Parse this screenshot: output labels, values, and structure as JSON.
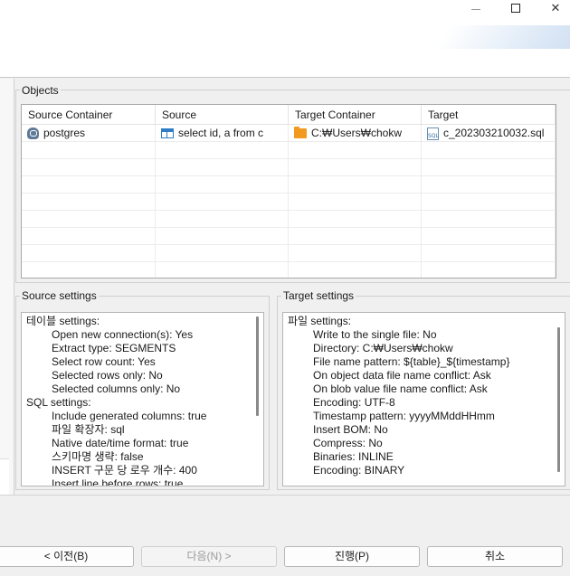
{
  "window": {
    "minimize_icon": "minimize-icon",
    "maximize_icon": "maximize-icon",
    "close_icon": "close-icon",
    "close_glyph": "✕"
  },
  "objects": {
    "title": "Objects",
    "columns": [
      "Source Container",
      "Source",
      "Target Container",
      "Target"
    ],
    "rows": [
      {
        "source_container": "postgres",
        "source_container_icon": "postgres-icon",
        "source": "select id, a from c",
        "source_icon": "table-icon",
        "target_container": "C:₩Users₩chokw",
        "target_container_icon": "folder-icon",
        "target": "c_202303210032.sql",
        "target_icon": "sql-file-icon"
      }
    ]
  },
  "source_settings": {
    "title": "Source settings",
    "lines": [
      {
        "text": "테이블 settings:",
        "indent": false
      },
      {
        "text": "Open new connection(s): Yes",
        "indent": true
      },
      {
        "text": "Extract type: SEGMENTS",
        "indent": true
      },
      {
        "text": "Select row count: Yes",
        "indent": true
      },
      {
        "text": "Selected rows only: No",
        "indent": true
      },
      {
        "text": "Selected columns only: No",
        "indent": true
      },
      {
        "text": "SQL settings:",
        "indent": false
      },
      {
        "text": "Include generated columns: true",
        "indent": true
      },
      {
        "text": "파일 확장자: sql",
        "indent": true
      },
      {
        "text": "Native date/time format: true",
        "indent": true
      },
      {
        "text": "스키마명 생략: false",
        "indent": true
      },
      {
        "text": "INSERT 구문 당 로우 개수: 400",
        "indent": true
      },
      {
        "text": "Insert line before rows: true",
        "indent": true
      }
    ]
  },
  "target_settings": {
    "title": "Target settings",
    "lines": [
      {
        "text": "파일 settings:",
        "indent": false
      },
      {
        "text": "Write to the single file: No",
        "indent": true
      },
      {
        "text": "Directory: C:₩Users₩chokw",
        "indent": true
      },
      {
        "text": "File name pattern: ${table}_${timestamp}",
        "indent": true
      },
      {
        "text": "On object data file name conflict: Ask",
        "indent": true
      },
      {
        "text": "On blob value file name conflict: Ask",
        "indent": true
      },
      {
        "text": "Encoding: UTF-8",
        "indent": true
      },
      {
        "text": "Timestamp pattern: yyyyMMddHHmm",
        "indent": true
      },
      {
        "text": "Insert BOM: No",
        "indent": true
      },
      {
        "text": "Compress: No",
        "indent": true
      },
      {
        "text": "Binaries: INLINE",
        "indent": true
      },
      {
        "text": "Encoding: BINARY",
        "indent": true
      }
    ]
  },
  "buttons": {
    "back": "< 이전(B)",
    "next": "다음(N) >",
    "proceed": "진행(P)",
    "cancel": "취소"
  }
}
